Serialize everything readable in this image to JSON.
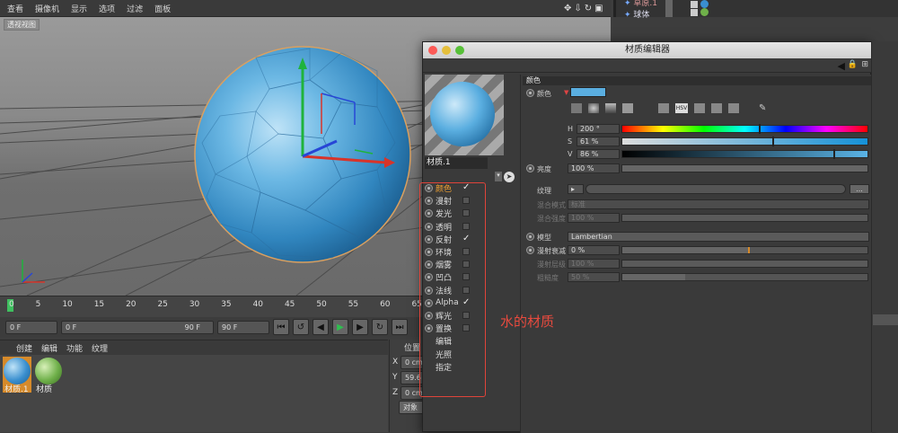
{
  "menu": [
    "查看",
    "摄像机",
    "显示",
    "选项",
    "过滤",
    "面板"
  ],
  "viewport": {
    "label": "透视视图"
  },
  "objects": [
    {
      "name": "草原.1"
    },
    {
      "name": "球体"
    }
  ],
  "timeline": {
    "ticks": [
      "0",
      "5",
      "10",
      "15",
      "20",
      "25",
      "30",
      "35",
      "40",
      "45",
      "50",
      "55",
      "60",
      "65"
    ],
    "start": "0 F",
    "range_start": "0 F",
    "range_end": "90 F",
    "end": "90 F"
  },
  "matmgr": {
    "menu": [
      "创建",
      "编辑",
      "功能",
      "纹理"
    ],
    "materials": [
      {
        "name": "材质.1",
        "color": "#3a8fcf"
      },
      {
        "name": "材质",
        "color": "#6fb04a"
      }
    ]
  },
  "coord": {
    "title": "位置",
    "x": "0 cm",
    "y": "59.6",
    "z": "0 cm",
    "btn": "对象"
  },
  "editor": {
    "title": "材质编辑器",
    "name": "材质.1",
    "channels": [
      {
        "label": "颜色",
        "check": "on",
        "active": true
      },
      {
        "label": "漫射",
        "check": "off"
      },
      {
        "label": "发光",
        "check": "off"
      },
      {
        "label": "透明",
        "check": "off"
      },
      {
        "label": "反射",
        "check": "on"
      },
      {
        "label": "环境",
        "check": "off"
      },
      {
        "label": "烟雾",
        "check": "off"
      },
      {
        "label": "凹凸",
        "check": "off"
      },
      {
        "label": "法线",
        "check": "off"
      },
      {
        "label": "Alpha",
        "check": "on"
      },
      {
        "label": "辉光",
        "check": "off"
      },
      {
        "label": "置换",
        "check": "off"
      },
      {
        "label": "编辑",
        "check": "none"
      },
      {
        "label": "光照",
        "check": "none"
      },
      {
        "label": "指定",
        "check": "none"
      }
    ],
    "section": "颜色",
    "color_label": "颜色",
    "color_hex": "#5aaee0",
    "h": {
      "label": "H",
      "value": "200 °",
      "pos": 0.555
    },
    "s": {
      "label": "S",
      "value": "61 %",
      "pos": 0.61
    },
    "v": {
      "label": "V",
      "value": "86 %",
      "pos": 0.86
    },
    "brightness": {
      "label": "亮度",
      "value": "100 %"
    },
    "texture": {
      "label": "纹理",
      "btn": "..."
    },
    "blend_mode": {
      "label": "混合模式",
      "value": "标准"
    },
    "blend_strength": {
      "label": "混合强度",
      "value": "100 %"
    },
    "model": {
      "label": "模型",
      "value": "Lambertian"
    },
    "diffuse_falloff": {
      "label": "漫射衰减",
      "value": "0 %"
    },
    "diffuse_level": {
      "label": "漫射层级",
      "value": "100 %"
    },
    "roughness": {
      "label": "粗糙度",
      "value": "50 %"
    }
  },
  "annotation": "水的材质"
}
